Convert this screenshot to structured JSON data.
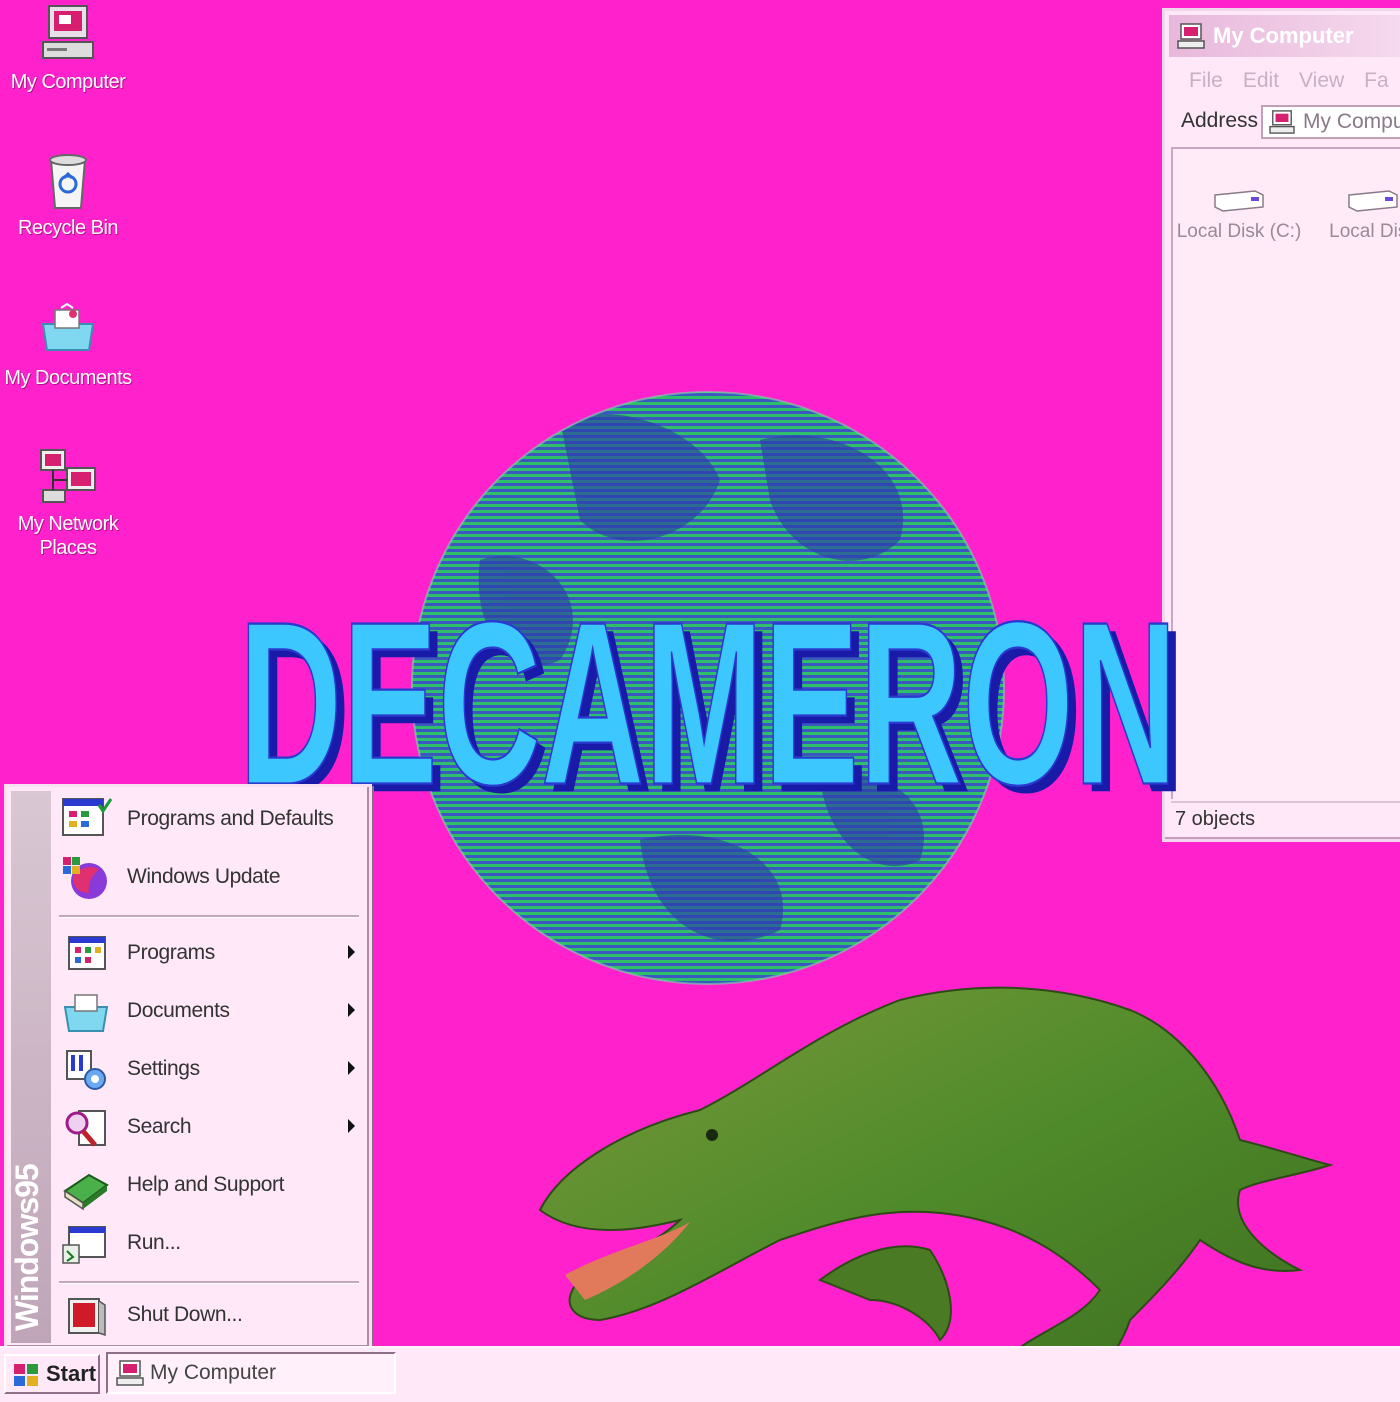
{
  "desktop": {
    "icons": [
      {
        "label": "My Computer"
      },
      {
        "label": "Recycle Bin"
      },
      {
        "label": "My Documents"
      },
      {
        "label": "My Network\nPlaces"
      }
    ]
  },
  "window": {
    "title": "My Computer",
    "menu": [
      "File",
      "Edit",
      "View",
      "Fa"
    ],
    "address_label": "Address",
    "address_value": "My Compute",
    "disks": [
      "Local Disk (C:)",
      "Local Disk"
    ],
    "status": "7 objects"
  },
  "artwork": {
    "title": "DECAMERON"
  },
  "start_menu": {
    "banner": "Windows95",
    "items": [
      {
        "label": "Programs and Defaults",
        "submenu": false
      },
      {
        "label": "Windows Update",
        "submenu": false
      },
      {
        "label": "Programs",
        "submenu": true
      },
      {
        "label": "Documents",
        "submenu": true
      },
      {
        "label": "Settings",
        "submenu": true
      },
      {
        "label": "Search",
        "submenu": true
      },
      {
        "label": "Help and Support",
        "submenu": false
      },
      {
        "label": "Run...",
        "submenu": false
      },
      {
        "label": "Shut Down...",
        "submenu": false
      }
    ]
  },
  "taskbar": {
    "start_label": "Start",
    "task_label": "My Computer"
  },
  "colors": {
    "desktop": "#ff22cc",
    "title_fill": "#3cc8ff",
    "title_shadow": "#1a1aa8",
    "globe_green": "#2fbf6a",
    "globe_blue": "#3a58c0"
  }
}
